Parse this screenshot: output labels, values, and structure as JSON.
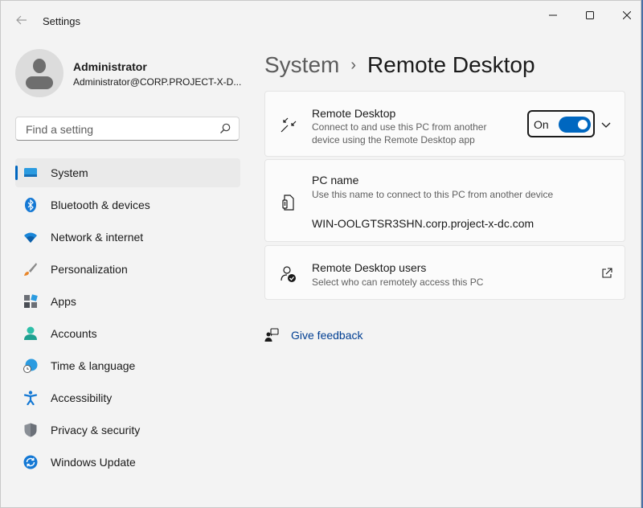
{
  "window": {
    "title": "Settings"
  },
  "profile": {
    "name": "Administrator",
    "email": "Administrator@CORP.PROJECT-X-D..."
  },
  "search": {
    "placeholder": "Find a setting"
  },
  "nav": {
    "items": [
      {
        "label": "System",
        "icon": "system-icon",
        "active": true
      },
      {
        "label": "Bluetooth & devices",
        "icon": "bluetooth-icon"
      },
      {
        "label": "Network & internet",
        "icon": "wifi-icon"
      },
      {
        "label": "Personalization",
        "icon": "brush-icon"
      },
      {
        "label": "Apps",
        "icon": "apps-icon"
      },
      {
        "label": "Accounts",
        "icon": "person-icon"
      },
      {
        "label": "Time & language",
        "icon": "globe-clock-icon"
      },
      {
        "label": "Accessibility",
        "icon": "accessibility-icon"
      },
      {
        "label": "Privacy & security",
        "icon": "shield-icon"
      },
      {
        "label": "Windows Update",
        "icon": "update-icon"
      }
    ]
  },
  "breadcrumb": {
    "parent": "System",
    "separator": "›",
    "current": "Remote Desktop"
  },
  "remote_desktop": {
    "title": "Remote Desktop",
    "description_line1": "Connect to and use this PC from another",
    "description_line2": "device using the Remote Desktop app",
    "toggle_label": "On",
    "toggle_on": true
  },
  "pc_name": {
    "title": "PC name",
    "description": "Use this name to connect to this PC from another device",
    "value": "WIN-OOLGTSR3SHN.corp.project-x-dc.com"
  },
  "users": {
    "title": "Remote Desktop users",
    "description": "Select who can remotely access this PC"
  },
  "feedback": {
    "label": "Give feedback"
  },
  "colors": {
    "accent": "#0067c0",
    "link": "#003e92",
    "background": "#f3f3f3",
    "card": "#fbfbfb"
  }
}
